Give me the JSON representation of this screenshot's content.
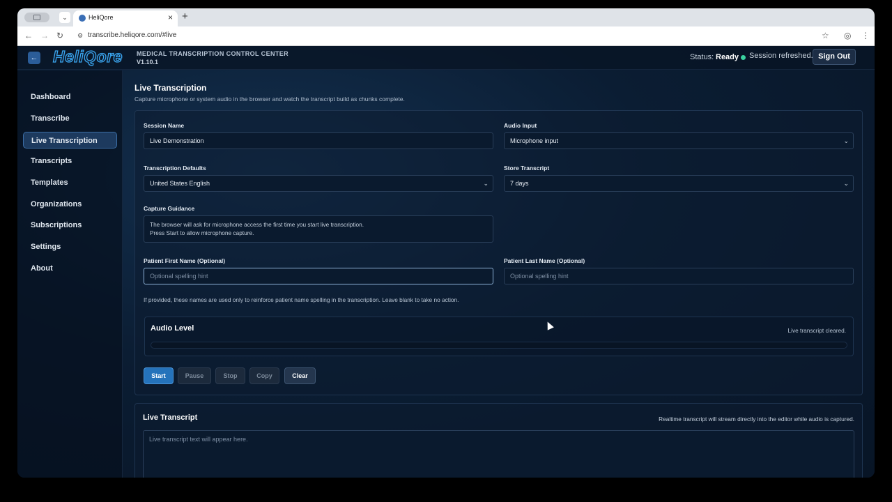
{
  "browser": {
    "tab_title": "HeliQore",
    "url": "transcribe.heliqore.com/#live"
  },
  "header": {
    "logo": "HeliQore",
    "center_title": "MEDICAL TRANSCRIPTION CONTROL CENTER",
    "version": "V1.10.1",
    "status_label": "Status:",
    "status_value": "Ready",
    "session_message": "Session refreshed.",
    "sign_out": "Sign Out"
  },
  "sidebar": {
    "items": [
      {
        "label": "Dashboard"
      },
      {
        "label": "Transcribe"
      },
      {
        "label": "Live Transcription"
      },
      {
        "label": "Transcripts"
      },
      {
        "label": "Templates"
      },
      {
        "label": "Organizations"
      },
      {
        "label": "Subscriptions"
      },
      {
        "label": "Settings"
      },
      {
        "label": "About"
      }
    ],
    "active": "Live Transcription"
  },
  "page": {
    "title": "Live Transcription",
    "subtitle": "Capture microphone or system audio in the browser and watch the transcript build as chunks complete."
  },
  "form": {
    "session_name_label": "Session Name",
    "session_name_value": "Live Demonstration",
    "audio_input_label": "Audio Input",
    "audio_input_value": "Microphone input",
    "defaults_label": "Transcription Defaults",
    "defaults_value": "United States English",
    "store_label": "Store Transcript",
    "store_value": "7 days",
    "guidance_label": "Capture Guidance",
    "guidance_line1": "The browser will ask for microphone access the first time you start live transcription.",
    "guidance_line2": "Press Start to allow microphone capture.",
    "first_name_label": "Patient First Name (Optional)",
    "first_name_placeholder": "Optional spelling hint",
    "last_name_label": "Patient Last Name (Optional)",
    "last_name_placeholder": "Optional spelling hint",
    "name_hint": "If provided, these names are used only to reinforce patient name spelling in the transcription. Leave blank to take no action."
  },
  "audio": {
    "title": "Audio Level",
    "status": "Live transcript cleared.",
    "level": 0
  },
  "controls": {
    "start": "Start",
    "pause": "Pause",
    "stop": "Stop",
    "copy": "Copy",
    "clear": "Clear"
  },
  "transcript": {
    "title": "Live Transcript",
    "note": "Realtime transcript will stream directly into the editor while audio is captured.",
    "placeholder": "Live transcript text will appear here."
  },
  "colors": {
    "accent": "#2573bb",
    "status_dot": "#3ad29f",
    "background": "#0a1628"
  }
}
